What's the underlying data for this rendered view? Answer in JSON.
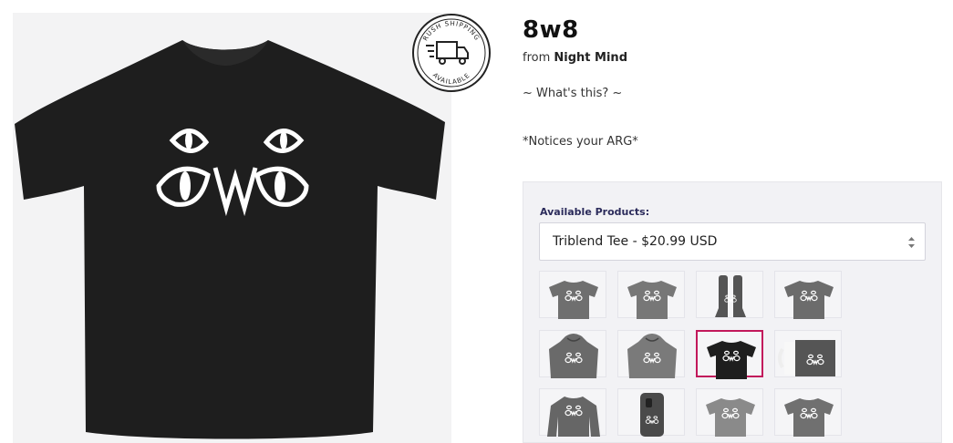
{
  "product": {
    "title": "8w8",
    "from_prefix": "from",
    "store": "Night Mind",
    "description_1": "~ What's this? ~",
    "description_2": "*Notices your ARG*"
  },
  "badge": {
    "top_text": "RUSH SHIPPING",
    "bottom_text": "AVAILABLE"
  },
  "panel": {
    "label": "Available Products:",
    "selected_value": "Triblend Tee - $20.99 USD"
  },
  "thumbnails": [
    {
      "name": "thumb-tee-grey",
      "kind": "tee",
      "color": "#6f6f6f",
      "selected": false
    },
    {
      "name": "thumb-tee-grey-2",
      "kind": "tee",
      "color": "#777777",
      "selected": false
    },
    {
      "name": "thumb-socks",
      "kind": "socks",
      "color": "#555555",
      "selected": false
    },
    {
      "name": "thumb-tee-grey-3",
      "kind": "tee",
      "color": "#6c6c6c",
      "selected": false
    },
    {
      "name": "thumb-hoodie",
      "kind": "hoodie",
      "color": "#6a6a6a",
      "selected": false
    },
    {
      "name": "thumb-zip-hoodie",
      "kind": "hoodie",
      "color": "#7a7a7a",
      "selected": false
    },
    {
      "name": "thumb-triblend-tee",
      "kind": "tee",
      "color": "#1e1e1e",
      "selected": true
    },
    {
      "name": "thumb-mug",
      "kind": "mug",
      "color": "#555555",
      "selected": false
    },
    {
      "name": "thumb-sweatshirt",
      "kind": "sweatshirt",
      "color": "#666666",
      "selected": false
    },
    {
      "name": "thumb-phone-case",
      "kind": "phone",
      "color": "#4a4a4a",
      "selected": false
    },
    {
      "name": "thumb-tee-light",
      "kind": "tee",
      "color": "#8a8a8a",
      "selected": false
    },
    {
      "name": "thumb-tee-grey-4",
      "kind": "tee",
      "color": "#707070",
      "selected": false
    }
  ],
  "colors": {
    "accent": "#c2185b",
    "label": "#2b2b5b",
    "shirt": "#1e1e1e"
  }
}
